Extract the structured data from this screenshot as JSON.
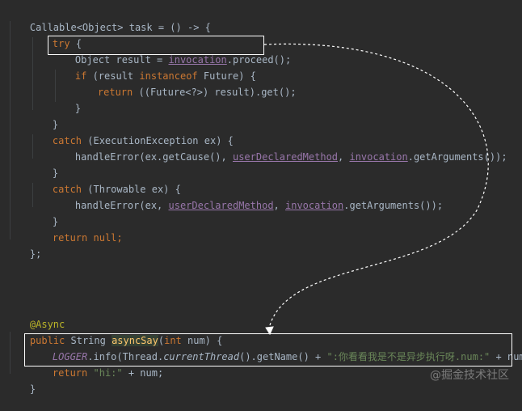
{
  "colors": {
    "background": "#2b2b2b",
    "keyword": "#cc7832",
    "text": "#a9b7c6",
    "field": "#9876aa",
    "method": "#ffc66d",
    "string": "#6a8759",
    "annotation": "#bbb529",
    "highlight_box": "#ffffff"
  },
  "code": {
    "l01": [
      "Callable<Object> task = () -> {"
    ],
    "l02": [
      "try",
      " {"
    ],
    "l03": [
      "Object result = ",
      "invocation",
      ".proceed();"
    ],
    "l04": [
      "if",
      " (result ",
      "instanceof",
      " Future) {"
    ],
    "l05": [
      "return",
      " ((Future<?>) result).get();"
    ],
    "l06": [
      "}"
    ],
    "l07": [
      "}"
    ],
    "l08": [
      "catch",
      " (ExecutionException ex) {"
    ],
    "l09": [
      "handleError(ex.getCause(), ",
      "userDeclaredMethod",
      ", ",
      "invocation",
      ".getArguments());"
    ],
    "l10": [
      "}"
    ],
    "l11": [
      "catch",
      " (Throwable ex) {"
    ],
    "l12": [
      "handleError(ex, ",
      "userDeclaredMethod",
      ", ",
      "invocation",
      ".getArguments());"
    ],
    "l13": [
      "}"
    ],
    "l14": [
      "return",
      " ",
      "null",
      ";"
    ],
    "l15": [
      "};"
    ],
    "l16": [
      "@Async"
    ],
    "l17": [
      "public",
      " String ",
      "asyncSay",
      "(",
      "int",
      " num) {"
    ],
    "l18": [
      "LOGGER",
      ".info(Thread.",
      "currentThread",
      "().getName() + ",
      "\":你看看我是不是异步执行呀.num:\"",
      " + num);"
    ],
    "l19": [
      "return",
      " ",
      "\"hi:\"",
      " + num;"
    ],
    "l20": [
      "}"
    ]
  },
  "watermark": {
    "text": "@掘金技术社区"
  }
}
